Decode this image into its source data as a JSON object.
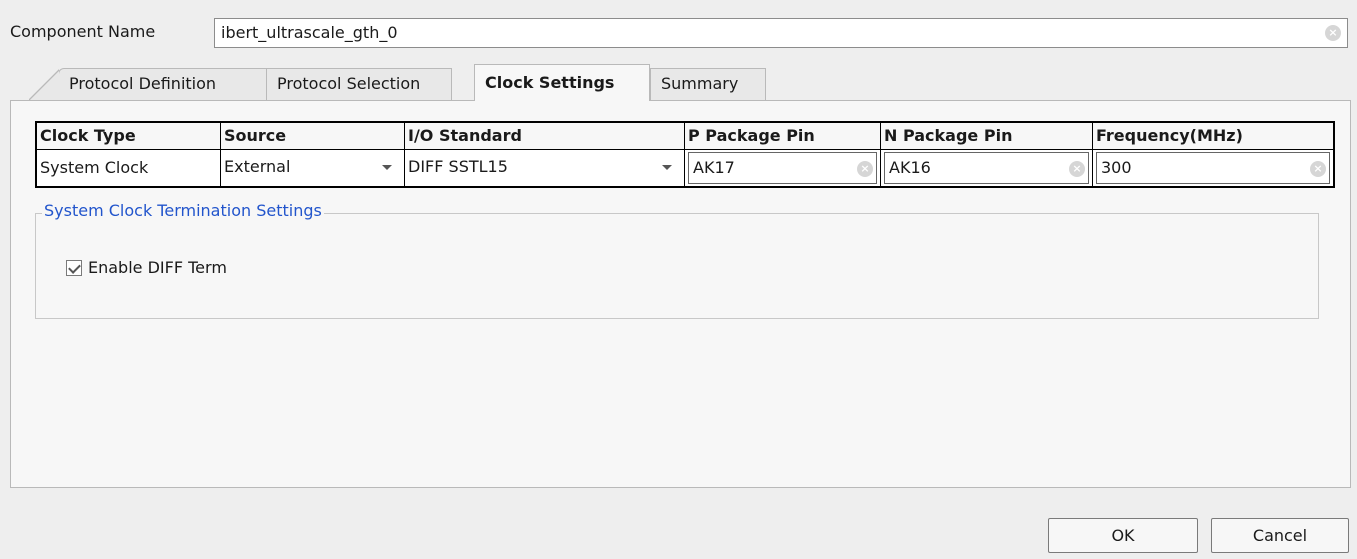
{
  "component": {
    "label": "Component Name",
    "value": "ibert_ultrascale_gth_0"
  },
  "tabs": [
    {
      "label": "Protocol Definition",
      "active": false
    },
    {
      "label": "Protocol Selection",
      "active": false
    },
    {
      "label": "Clock Settings",
      "active": true
    },
    {
      "label": "Summary",
      "active": false
    }
  ],
  "clock_table": {
    "headers": [
      "Clock Type",
      "Source",
      "I/O Standard",
      "P Package Pin",
      "N Package Pin",
      "Frequency(MHz)"
    ],
    "row": {
      "clock_type": "System Clock",
      "source": "External",
      "io_standard": "DIFF SSTL15",
      "p_pin": "AK17",
      "n_pin": "AK16",
      "frequency": "300"
    }
  },
  "termination": {
    "title": "System Clock Termination Settings",
    "enable_diff_term_label": "Enable DIFF Term",
    "enable_diff_term_checked": true
  },
  "buttons": {
    "ok": "OK",
    "cancel": "Cancel"
  },
  "icons": {
    "clear": "clear-icon",
    "dropdown": "chevron-down-icon",
    "check": "checkmark-icon"
  }
}
